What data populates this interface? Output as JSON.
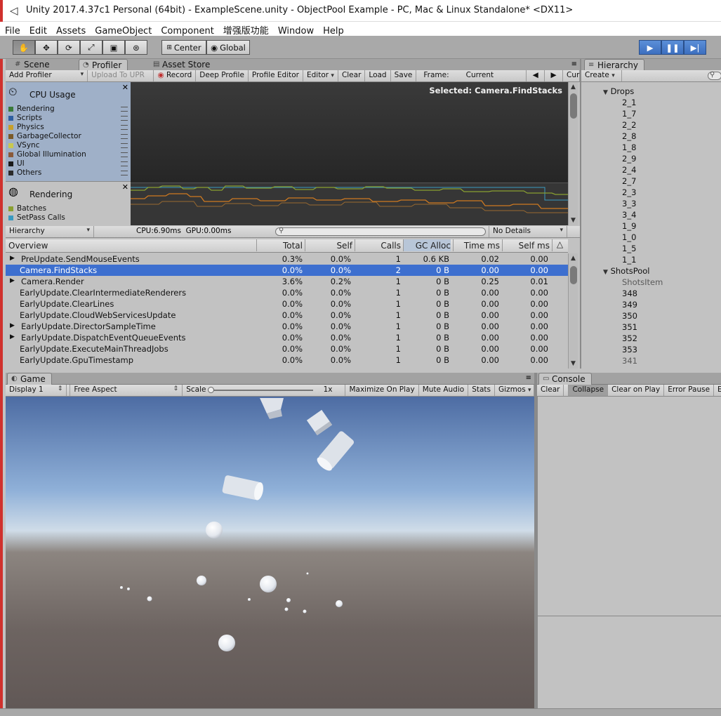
{
  "window": {
    "title": "Unity 2017.4.37c1 Personal (64bit) - ExampleScene.unity - ObjectPool Example - PC, Mac & Linux Standalone* <DX11>"
  },
  "menu": [
    "File",
    "Edit",
    "Assets",
    "GameObject",
    "Component",
    "增强版功能",
    "Window",
    "Help"
  ],
  "toolbar": {
    "center": "Center",
    "global": "Global"
  },
  "tabs_top": {
    "scene": "Scene",
    "profiler": "Profiler",
    "asset_store": "Asset Store"
  },
  "profiler_toolbar": {
    "add_profiler": "Add Profiler",
    "upload": "Upload To UPR",
    "record": "Record",
    "deep_profile": "Deep Profile",
    "profile_editor": "Profile Editor",
    "editor": "Editor",
    "clear": "Clear",
    "load": "Load",
    "save": "Save",
    "frame_label": "Frame:",
    "frame_value": "Current",
    "cur": "Cur"
  },
  "cpu": {
    "title": "CPU Usage",
    "items": [
      {
        "label": "Rendering",
        "color": "#3a7a3a"
      },
      {
        "label": "Scripts",
        "color": "#2f5fa0"
      },
      {
        "label": "Physics",
        "color": "#c8a02a"
      },
      {
        "label": "GarbageCollector",
        "color": "#7a5a28"
      },
      {
        "label": "VSync",
        "color": "#c8c850"
      },
      {
        "label": "Global Illumination",
        "color": "#8a5a3a"
      },
      {
        "label": "UI",
        "color": "#1a1a1a"
      },
      {
        "label": "Others",
        "color": "#2b2b2b"
      }
    ],
    "selected": "Selected: Camera.FindStacks"
  },
  "render": {
    "title": "Rendering",
    "items": [
      {
        "label": "Batches",
        "color": "#8aa030"
      },
      {
        "label": "SetPass Calls",
        "color": "#3a9ac0"
      }
    ]
  },
  "profiler_bar": {
    "view": "Hierarchy",
    "cpu_time": "CPU:6.90ms",
    "gpu_time": "GPU:0.00ms",
    "search_placeholder": "",
    "details": "No Details"
  },
  "table": {
    "headers": {
      "overview": "Overview",
      "total": "Total",
      "self": "Self",
      "calls": "Calls",
      "gc": "GC Alloc",
      "time": "Time ms",
      "selfms": "Self ms"
    },
    "rows": [
      {
        "name": "PreUpdate.SendMouseEvents",
        "arrow": "▶",
        "total": "0.3%",
        "self": "0.0%",
        "calls": "1",
        "gc": "0.6 KB",
        "time": "0.02",
        "selfms": "0.00"
      },
      {
        "name": "Camera.FindStacks",
        "arrow": "",
        "total": "0.0%",
        "self": "0.0%",
        "calls": "2",
        "gc": "0 B",
        "time": "0.00",
        "selfms": "0.00",
        "selected": true
      },
      {
        "name": "Camera.Render",
        "arrow": "▶",
        "total": "3.6%",
        "self": "0.2%",
        "calls": "1",
        "gc": "0 B",
        "time": "0.25",
        "selfms": "0.01"
      },
      {
        "name": "EarlyUpdate.ClearIntermediateRenderers",
        "arrow": "",
        "total": "0.0%",
        "self": "0.0%",
        "calls": "1",
        "gc": "0 B",
        "time": "0.00",
        "selfms": "0.00"
      },
      {
        "name": "EarlyUpdate.ClearLines",
        "arrow": "",
        "total": "0.0%",
        "self": "0.0%",
        "calls": "1",
        "gc": "0 B",
        "time": "0.00",
        "selfms": "0.00"
      },
      {
        "name": "EarlyUpdate.CloudWebServicesUpdate",
        "arrow": "",
        "total": "0.0%",
        "self": "0.0%",
        "calls": "1",
        "gc": "0 B",
        "time": "0.00",
        "selfms": "0.00"
      },
      {
        "name": "EarlyUpdate.DirectorSampleTime",
        "arrow": "▶",
        "total": "0.0%",
        "self": "0.0%",
        "calls": "1",
        "gc": "0 B",
        "time": "0.00",
        "selfms": "0.00"
      },
      {
        "name": "EarlyUpdate.DispatchEventQueueEvents",
        "arrow": "▶",
        "total": "0.0%",
        "self": "0.0%",
        "calls": "1",
        "gc": "0 B",
        "time": "0.00",
        "selfms": "0.00"
      },
      {
        "name": "EarlyUpdate.ExecuteMainThreadJobs",
        "arrow": "",
        "total": "0.0%",
        "self": "0.0%",
        "calls": "1",
        "gc": "0 B",
        "time": "0.00",
        "selfms": "0.00"
      },
      {
        "name": "EarlyUpdate.GpuTimestamp",
        "arrow": "",
        "total": "0.0%",
        "self": "0.0%",
        "calls": "1",
        "gc": "0 B",
        "time": "0.00",
        "selfms": "0.00"
      }
    ]
  },
  "hierarchy": {
    "tab": "Hierarchy",
    "create": "Create",
    "items": [
      {
        "label": "Drops",
        "indent": 1,
        "arrow": "▼",
        "grey": false
      },
      {
        "label": "2_1",
        "indent": 2,
        "arrow": "",
        "grey": false
      },
      {
        "label": "1_7",
        "indent": 2,
        "arrow": "",
        "grey": false
      },
      {
        "label": "2_2",
        "indent": 2,
        "arrow": "",
        "grey": false
      },
      {
        "label": "2_8",
        "indent": 2,
        "arrow": "",
        "grey": false
      },
      {
        "label": "1_8",
        "indent": 2,
        "arrow": "",
        "grey": false
      },
      {
        "label": "2_9",
        "indent": 2,
        "arrow": "",
        "grey": false
      },
      {
        "label": "2_4",
        "indent": 2,
        "arrow": "",
        "grey": false
      },
      {
        "label": "2_7",
        "indent": 2,
        "arrow": "",
        "grey": false
      },
      {
        "label": "2_3",
        "indent": 2,
        "arrow": "",
        "grey": false
      },
      {
        "label": "3_3",
        "indent": 2,
        "arrow": "",
        "grey": false
      },
      {
        "label": "3_4",
        "indent": 2,
        "arrow": "",
        "grey": false
      },
      {
        "label": "1_9",
        "indent": 2,
        "arrow": "",
        "grey": false
      },
      {
        "label": "1_0",
        "indent": 2,
        "arrow": "",
        "grey": false
      },
      {
        "label": "1_5",
        "indent": 2,
        "arrow": "",
        "grey": false
      },
      {
        "label": "1_1",
        "indent": 2,
        "arrow": "",
        "grey": false
      },
      {
        "label": "ShotsPool",
        "indent": 1,
        "arrow": "▼",
        "grey": false
      },
      {
        "label": "ShotsItem",
        "indent": 2,
        "arrow": "",
        "grey": true
      },
      {
        "label": "348",
        "indent": 2,
        "arrow": "",
        "grey": false
      },
      {
        "label": "349",
        "indent": 2,
        "arrow": "",
        "grey": false
      },
      {
        "label": "350",
        "indent": 2,
        "arrow": "",
        "grey": false
      },
      {
        "label": "351",
        "indent": 2,
        "arrow": "",
        "grey": false
      },
      {
        "label": "352",
        "indent": 2,
        "arrow": "",
        "grey": false
      },
      {
        "label": "353",
        "indent": 2,
        "arrow": "",
        "grey": false
      },
      {
        "label": "341",
        "indent": 2,
        "arrow": "",
        "grey": true
      }
    ]
  },
  "game": {
    "tab": "Game",
    "display": "Display 1",
    "aspect": "Free Aspect",
    "scale_label": "Scale",
    "scale_value": "1x",
    "maximize": "Maximize On Play",
    "mute": "Mute Audio",
    "stats": "Stats",
    "gizmos": "Gizmos"
  },
  "console": {
    "tab": "Console",
    "clear": "Clear",
    "collapse": "Collapse",
    "clear_on_play": "Clear on Play",
    "error_pause": "Error Pause",
    "editor": "E"
  }
}
